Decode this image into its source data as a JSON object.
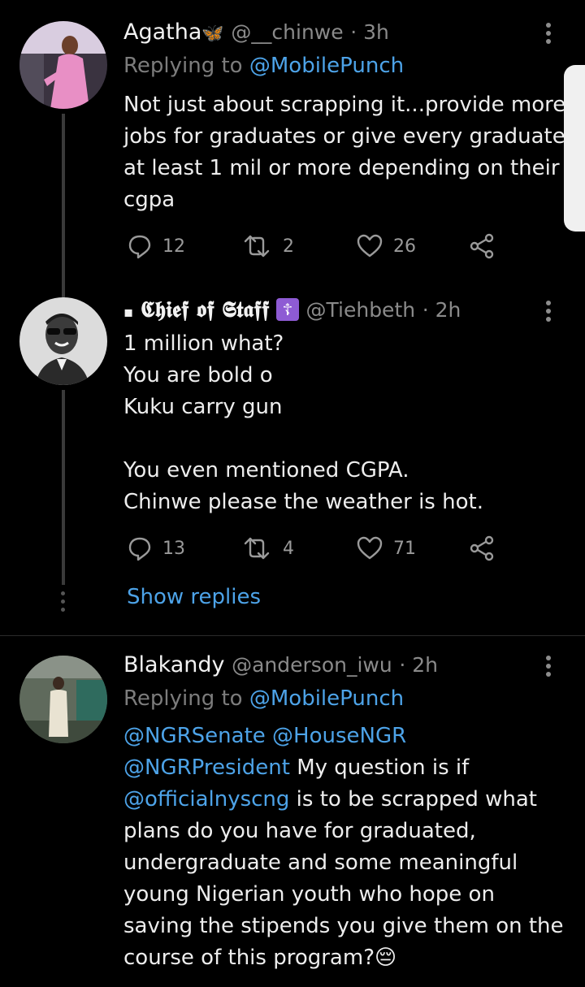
{
  "tweets": [
    {
      "name": "Agatha",
      "name_emoji": "🦋",
      "handle": "@__chinwe",
      "time": "· 3h",
      "replying_prefix": "Replying to ",
      "replying_to": "@MobilePunch",
      "text": "Not just about scrapping it...provide more jobs for graduates or give every graduate at least 1 mil or more depending on their cgpa",
      "replies": "12",
      "retweets": "2",
      "likes": "26"
    },
    {
      "name_prefix": "▪",
      "name": "𝕮𝖍𝖎𝖊𝖋 𝖔𝖋 𝕾𝖙𝖆𝖋𝖋",
      "name_emoji": "☦",
      "handle": "@Tiehbeth",
      "time": "· 2h",
      "text": "1 million what?\nYou are bold o\nKuku carry gun\n\nYou even mentioned CGPA.\nChinwe please the weather is hot.",
      "replies": "13",
      "retweets": "4",
      "likes": "71",
      "show_replies": "Show replies"
    },
    {
      "name": "Blakandy",
      "handle": "@anderson_iwu",
      "time": "· 2h",
      "replying_prefix": "Replying to ",
      "replying_to": "@MobilePunch",
      "mention1": "@NGRSenate",
      "mention2": "@HouseNGR",
      "mention3": "@NGRPresident",
      "text_a": " My question is if ",
      "mention4": "@officialnyscng",
      "text_b": " is to be scrapped what plans do you have for graduated, undergraduate and some meaningful young Nigerian youth who hope on saving the stipends you give them on the course of this program?",
      "emoji_end": "😔"
    }
  ],
  "icons": {
    "reply": "reply-icon",
    "retweet": "retweet-icon",
    "like": "heart-icon",
    "share": "share-icon",
    "more": "more-vertical-icon"
  },
  "colors": {
    "background": "#000000",
    "link": "#4da3e8",
    "muted": "#8a8a8a"
  }
}
